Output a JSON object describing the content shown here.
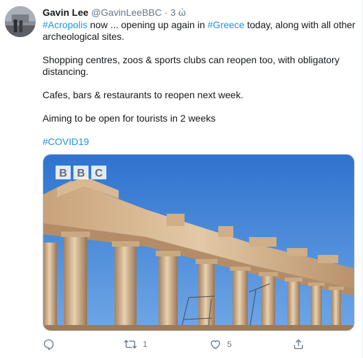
{
  "tweet": {
    "author_name": "Gavin Lee",
    "author_handle": "@GavinLeeBBC",
    "separator": "·",
    "time": "3 ώ",
    "line1_hashtag1": "#Acropolis",
    "line1_text1": " now ... opening up again in ",
    "line1_hashtag2": "#Greece",
    "line1_text2": " today, along with all other",
    "line2": "archeological sites.",
    "line3": "Shopping centres, zoos & sports clubs can reopen too, with obligatory",
    "line4": "distancing.",
    "line5": "Cafes, bars & restaurants to reopen next week.",
    "line6": "Aiming to be open for tourists in 2 weeks",
    "hashtag_covid": "#COVID19",
    "media_watermark": [
      "B",
      "B",
      "C"
    ]
  },
  "actions": {
    "reply_icon": "reply-icon",
    "retweet_icon": "retweet-icon",
    "retweet_count": "1",
    "like_icon": "heart-icon",
    "like_count": "5",
    "share_icon": "share-icon"
  },
  "colors": {
    "link": "#1b95e0",
    "muted": "#657786",
    "text": "#14171a",
    "sky": "#3b82d6"
  }
}
